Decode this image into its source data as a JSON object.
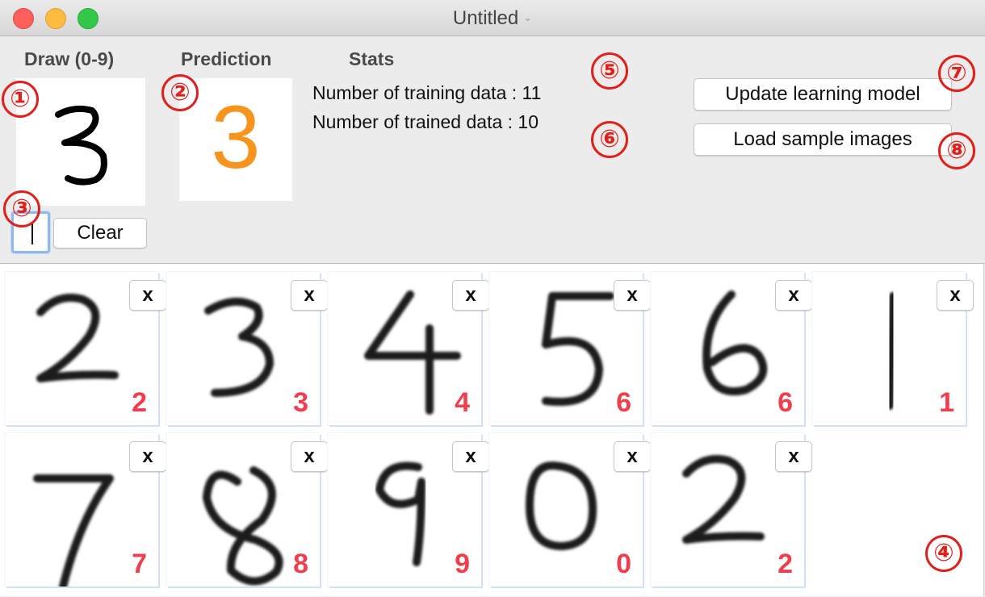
{
  "window": {
    "title": "Untitled"
  },
  "headings": {
    "draw": "Draw (0-9)",
    "prediction": "Prediction",
    "stats": "Stats"
  },
  "prediction": {
    "value": "3",
    "color": "#f7941d"
  },
  "stats": {
    "training_line": "Number of training data : 11",
    "trained_line": "Number of trained data : 10"
  },
  "buttons": {
    "update": "Update learning model",
    "load": "Load sample images",
    "clear": "Clear"
  },
  "annotations": [
    "①",
    "②",
    "③",
    "④",
    "⑤",
    "⑥",
    "⑦",
    "⑧"
  ],
  "samples": [
    {
      "digit": "2",
      "label": "2",
      "remove": "x"
    },
    {
      "digit": "3",
      "label": "3",
      "remove": "x"
    },
    {
      "digit": "4",
      "label": "4",
      "remove": "x"
    },
    {
      "digit": "5",
      "label": "6",
      "remove": "x"
    },
    {
      "digit": "6",
      "label": "6",
      "remove": "x"
    },
    {
      "digit": "1",
      "label": "1",
      "remove": "x"
    },
    {
      "digit": "7",
      "label": "7",
      "remove": "x"
    },
    {
      "digit": "8",
      "label": "8",
      "remove": "x"
    },
    {
      "digit": "9",
      "label": "9",
      "remove": "x"
    },
    {
      "digit": "0",
      "label": "0",
      "remove": "x"
    },
    {
      "digit": "2",
      "label": "2",
      "remove": "x"
    }
  ],
  "colors": {
    "annotation": "#e0201b",
    "label": "#ef3f4f",
    "accent": "#f7941d"
  }
}
